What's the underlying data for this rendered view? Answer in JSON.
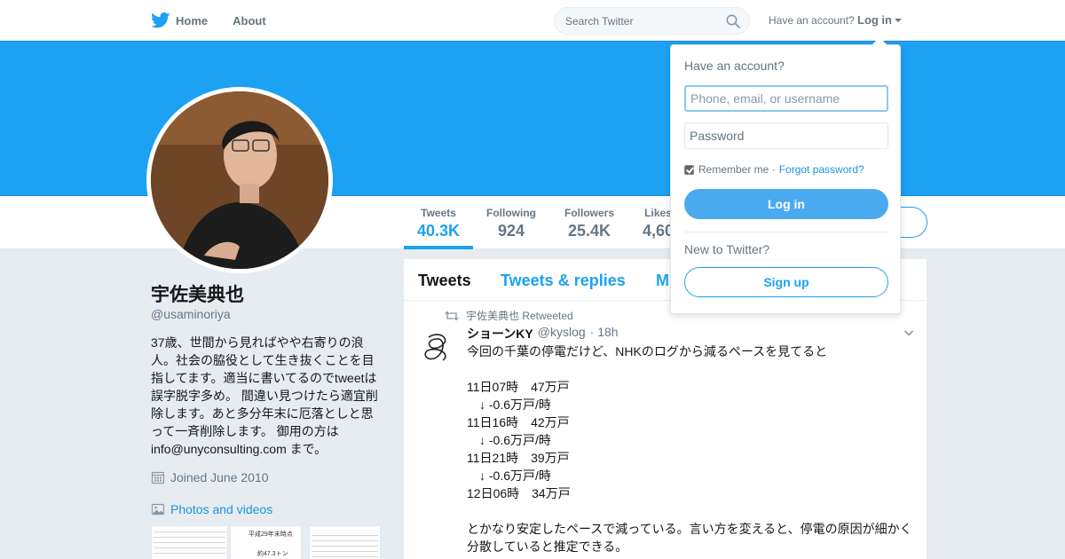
{
  "nav": {
    "home_label": "Home",
    "about_label": "About",
    "search_placeholder": "Search Twitter",
    "account_prompt": "Have an account?",
    "login_label": "Log in"
  },
  "profile": {
    "name": "宇佐美典也",
    "handle": "@usaminoriya",
    "bio": "37歳、世間から見ればやや右寄りの浪\n人。社会の脇役として生き抜くことを目\n指してます。適当に書いてるのでtweetは\n誤字脱字多め。 間違い見つけたら適宜削\n除します。あと多分年末に厄落としと思\n って一斉削除します。 御用の方は\ninfo@unyconsulting.com まで。",
    "joined": "Joined June 2010",
    "photos_link": "Photos and videos",
    "thumb2_title": "平成29年末時点",
    "thumb2_sub": "約47.3トン"
  },
  "stats": [
    {
      "label": "Tweets",
      "value": "40.3K"
    },
    {
      "label": "Following",
      "value": "924"
    },
    {
      "label": "Followers",
      "value": "25.4K"
    },
    {
      "label": "Likes",
      "value": "4,60"
    }
  ],
  "timeline": {
    "tabs": [
      "Tweets",
      "Tweets & replies",
      "M"
    ],
    "tweet": {
      "retweeted_by": "宇佐美典也 Retweeted",
      "author_name": "ショーンKY",
      "author_handle": "@kyslog",
      "time": "· 18h",
      "text": "今回の千葉の停電だけど、NHKのログから減るペースを見てると\n\n11日07時　47万戸\n　↓ -0.6万戸/時\n11日16時　42万戸\n　↓ -0.6万戸/時\n11日21時　39万戸\n　↓ -0.6万戸/時\n12日06時　34万戸\n\nとかなり安定したペースで減っている。言い方を変えると、停電の原因が細かく\n分散していると推定できる。"
    }
  },
  "login_dropdown": {
    "title": "Have an account?",
    "username_placeholder": "Phone, email, or username",
    "password_placeholder": "Password",
    "remember_label": "Remember me ·",
    "forgot_label": "Forgot password?",
    "login_button": "Log in",
    "new_prompt": "New to Twitter?",
    "signup_button": "Sign up"
  },
  "colors": {
    "brand": "#1da1f2",
    "background": "#e6ecf0"
  }
}
